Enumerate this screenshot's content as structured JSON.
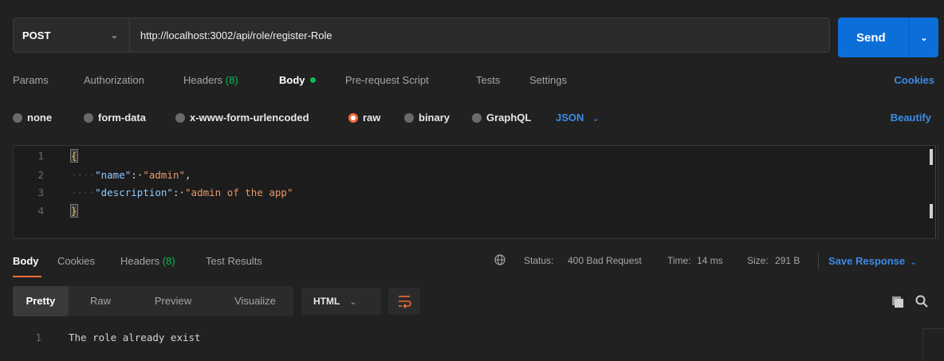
{
  "request": {
    "method": "POST",
    "url": "http://localhost:3002/api/role/register-Role",
    "send_label": "Send"
  },
  "request_tabs": [
    {
      "label": "Params"
    },
    {
      "label": "Authorization"
    },
    {
      "label": "Headers",
      "count": "(8)"
    },
    {
      "label": "Body"
    },
    {
      "label": "Pre-request Script"
    },
    {
      "label": "Tests"
    },
    {
      "label": "Settings"
    }
  ],
  "cookies_label": "Cookies",
  "body_types": [
    {
      "label": "none",
      "selected": false
    },
    {
      "label": "form-data",
      "selected": false
    },
    {
      "label": "x-www-form-urlencoded",
      "selected": false
    },
    {
      "label": "raw",
      "selected": true
    },
    {
      "label": "binary",
      "selected": false
    },
    {
      "label": "GraphQL",
      "selected": false
    }
  ],
  "raw_format": "JSON",
  "beautify_label": "Beautify",
  "editor": {
    "line_numbers": [
      "1",
      "2",
      "3",
      "4"
    ],
    "open_brace": "{",
    "close_brace": "}",
    "key1": "\"name\"",
    "val1": "\"admin\"",
    "key2": "\"description\"",
    "val2": "\"admin of the app\""
  },
  "response_tabs": [
    {
      "label": "Body"
    },
    {
      "label": "Cookies"
    },
    {
      "label": "Headers",
      "count": "(8)"
    },
    {
      "label": "Test Results"
    }
  ],
  "status": {
    "status_label": "Status:",
    "status_value": "400 Bad Request",
    "time_label": "Time:",
    "time_value": "14 ms",
    "size_label": "Size:",
    "size_value": "291 B"
  },
  "save_response_label": "Save Response",
  "view_tabs": [
    "Pretty",
    "Raw",
    "Preview",
    "Visualize"
  ],
  "response_format": "HTML",
  "response": {
    "line_number": "1",
    "text": "The role already exist"
  },
  "colors": {
    "accent": "#f26b3a",
    "link": "#3c8ce7",
    "status_ok": "#0cbb52",
    "send_button": "#0c6fd9"
  }
}
